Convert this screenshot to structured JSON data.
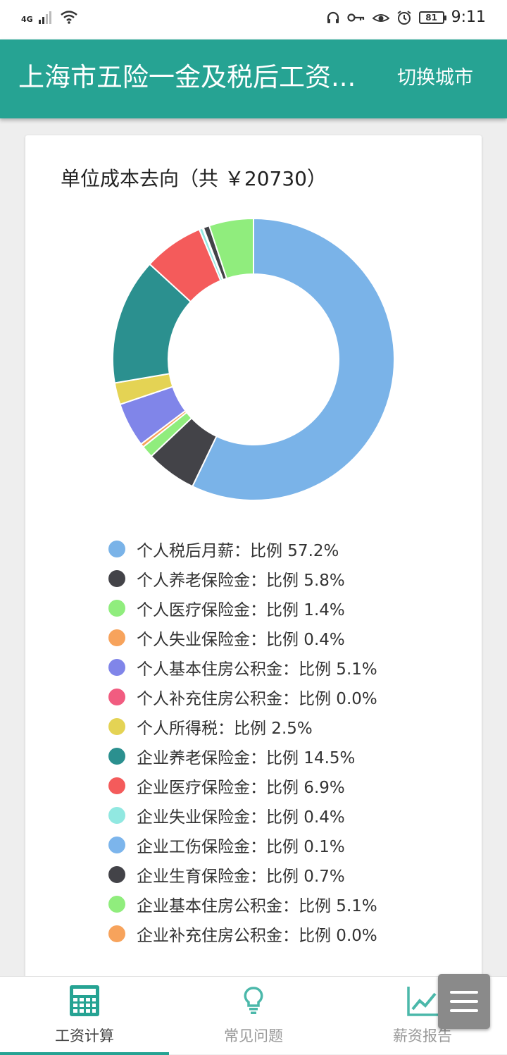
{
  "status_bar": {
    "network_type": "4G",
    "battery": "81",
    "time": "9:11",
    "icons": [
      "signal-icon",
      "wifi-icon",
      "headphones-icon",
      "key-icon",
      "eye-icon",
      "alarm-icon"
    ]
  },
  "app_bar": {
    "title": "上海市五险一金及税后工资...",
    "switch_city": "切换城市",
    "color": "#26a393"
  },
  "card": {
    "title": "单位成本去向（共 ￥20730）"
  },
  "chart_data": {
    "type": "pie",
    "total": 20730,
    "slices": [
      {
        "label": "个人税后月薪：比例 57.2%",
        "name": "个人税后月薪",
        "percent": 57.2,
        "color": "#7ab3e8"
      },
      {
        "label": "个人养老保险金：比例 5.8%",
        "name": "个人养老保险金",
        "percent": 5.8,
        "color": "#434348"
      },
      {
        "label": "个人医疗保险金：比例 1.4%",
        "name": "个人医疗保险金",
        "percent": 1.4,
        "color": "#90ed7d"
      },
      {
        "label": "个人失业保险金：比例 0.4%",
        "name": "个人失业保险金",
        "percent": 0.4,
        "color": "#f7a35c"
      },
      {
        "label": "个人基本住房公积金：比例 5.1%",
        "name": "个人基本住房公积金",
        "percent": 5.1,
        "color": "#8085e9"
      },
      {
        "label": "个人补充住房公积金：比例 0.0%",
        "name": "个人补充住房公积金",
        "percent": 0.0,
        "color": "#f15c80"
      },
      {
        "label": "个人所得税：比例 2.5%",
        "name": "个人所得税",
        "percent": 2.5,
        "color": "#e4d354"
      },
      {
        "label": "企业养老保险金：比例 14.5%",
        "name": "企业养老保险金",
        "percent": 14.5,
        "color": "#2b908f"
      },
      {
        "label": "企业医疗保险金：比例 6.9%",
        "name": "企业医疗保险金",
        "percent": 6.9,
        "color": "#f45b5b"
      },
      {
        "label": "企业失业保险金：比例 0.4%",
        "name": "企业失业保险金",
        "percent": 0.4,
        "color": "#91e8e1"
      },
      {
        "label": "企业工伤保险金：比例 0.1%",
        "name": "企业工伤保险金",
        "percent": 0.1,
        "color": "#7cb5ec"
      },
      {
        "label": "企业生育保险金：比例 0.7%",
        "name": "企业生育保险金",
        "percent": 0.7,
        "color": "#434348"
      },
      {
        "label": "企业基本住房公积金：比例 5.1%",
        "name": "企业基本住房公积金",
        "percent": 5.1,
        "color": "#90ed7d"
      },
      {
        "label": "企业补充住房公积金：比例 0.0%",
        "name": "企业补充住房公积金",
        "percent": 0.0,
        "color": "#f7a35c"
      }
    ]
  },
  "bottom_nav": {
    "tabs": [
      {
        "label": "工资计算",
        "icon": "calculator-icon",
        "active": true
      },
      {
        "label": "常见问题",
        "icon": "lightbulb-icon",
        "active": false
      },
      {
        "label": "薪资报告",
        "icon": "trend-chart-icon",
        "active": false
      }
    ]
  },
  "fab": {
    "icon": "menu-icon"
  }
}
